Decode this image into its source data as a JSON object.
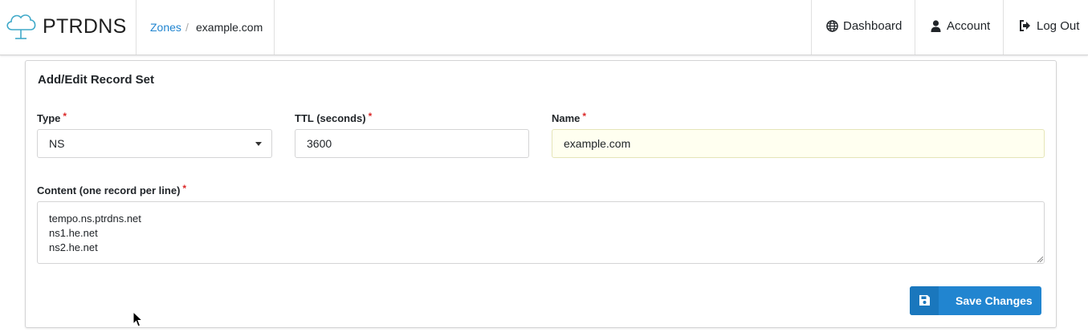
{
  "app": {
    "brand": "PTRDNS"
  },
  "breadcrumb": {
    "zones_label": "Zones",
    "separator": "/",
    "current": "example.com"
  },
  "nav": {
    "dashboard_label": "Dashboard",
    "account_label": "Account",
    "logout_label": "Log Out",
    "icons": [
      "globe-icon",
      "user-icon",
      "sign-out-icon"
    ]
  },
  "panel": {
    "title": "Add/Edit Record Set"
  },
  "form": {
    "type": {
      "label": "Type",
      "required_mark": "*",
      "value": "NS"
    },
    "ttl": {
      "label": "TTL (seconds)",
      "required_mark": "*",
      "value": "3600"
    },
    "name": {
      "label": "Name",
      "required_mark": "*",
      "value": "example.com"
    },
    "content": {
      "label": "Content (one record per line)",
      "required_mark": "*",
      "lines": [
        "tempo.ns.ptrdns.net",
        "ns1.he.net",
        "ns2.he.net"
      ]
    },
    "save_label": "Save Changes"
  },
  "colors": {
    "primary": "#2185d0",
    "required": "#db2828",
    "autofill_bg": "#fffff0"
  }
}
